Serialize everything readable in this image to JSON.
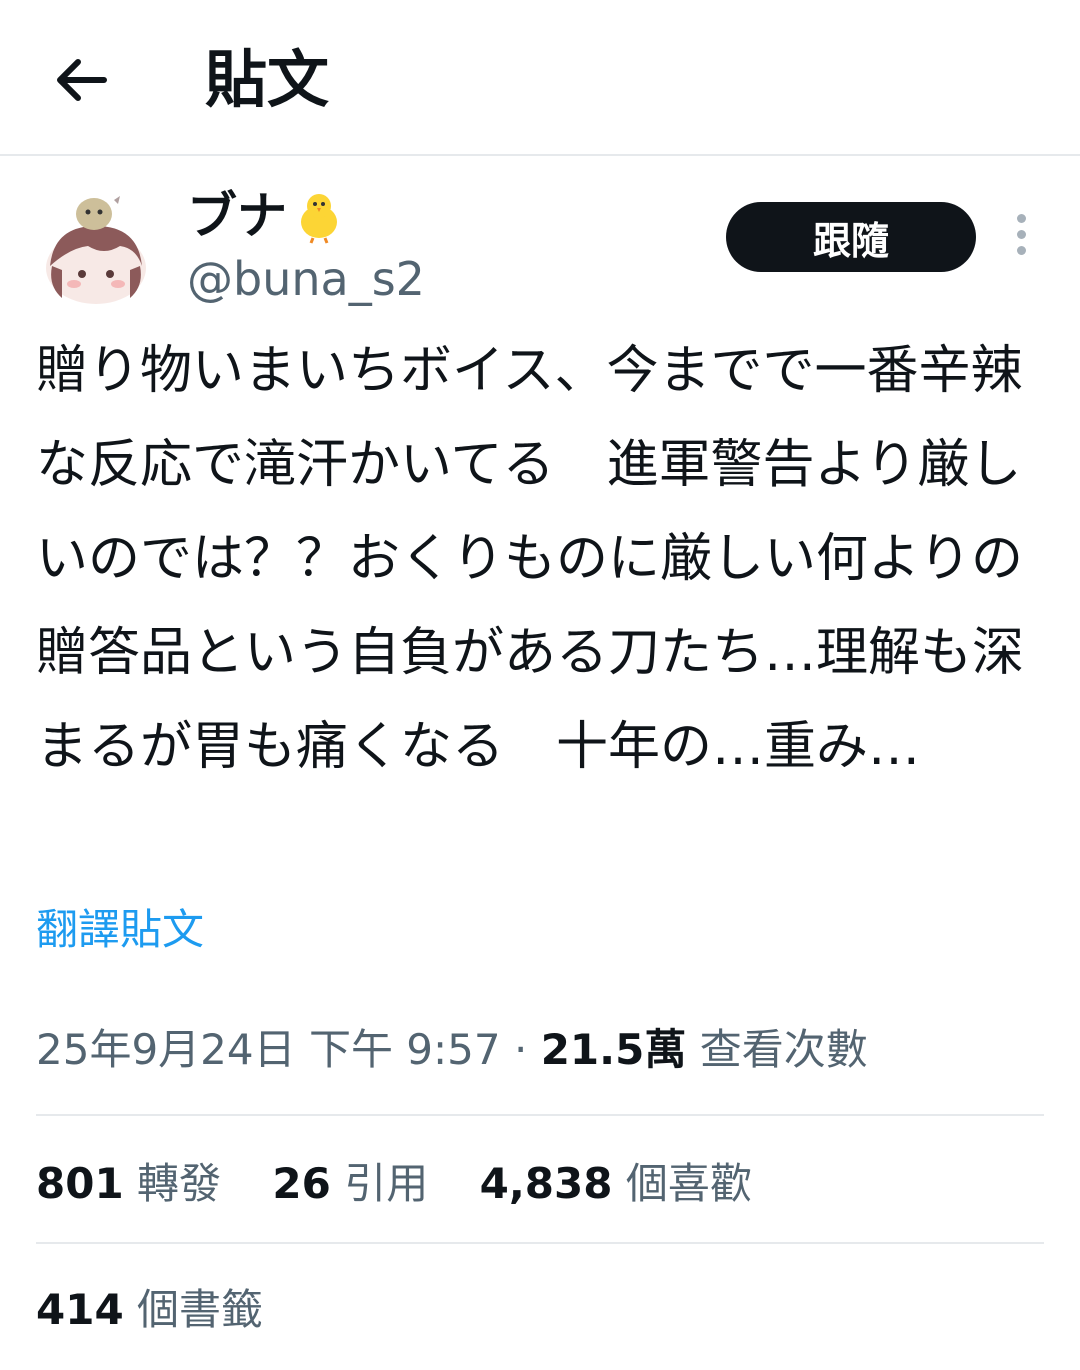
{
  "header": {
    "title": "貼文",
    "back_icon": "arrow-left-icon"
  },
  "author": {
    "display_name": "ブナ",
    "name_emoji": "chick-emoji-icon",
    "handle": "@buna_s2",
    "follow_label": "跟隨"
  },
  "post": {
    "text": "贈り物いまいちボイス、今までで一番辛辣な反応で滝汗かいてる　進軍警告より厳しいのでは？？おくりものに厳しい何よりの贈答品という自負がある刀たち…理解も深まるが胃も痛くなる　十年の…重み…",
    "translate_label": "翻譯貼文"
  },
  "meta": {
    "timestamp": "25年9月24日 下午 9:57",
    "separator": " · ",
    "views_count": "21.5萬",
    "views_label": "查看次數"
  },
  "stats": {
    "retweets_count": "801",
    "retweets_label": "轉發",
    "quotes_count": "26",
    "quotes_label": "引用",
    "likes_count": "4,838",
    "likes_label": "個喜歡",
    "bookmarks_count": "414",
    "bookmarks_label": "個書籤"
  },
  "colors": {
    "text": "#0f1419",
    "secondary": "#536471",
    "link": "#1d9bf0",
    "button": "#0f1419"
  }
}
